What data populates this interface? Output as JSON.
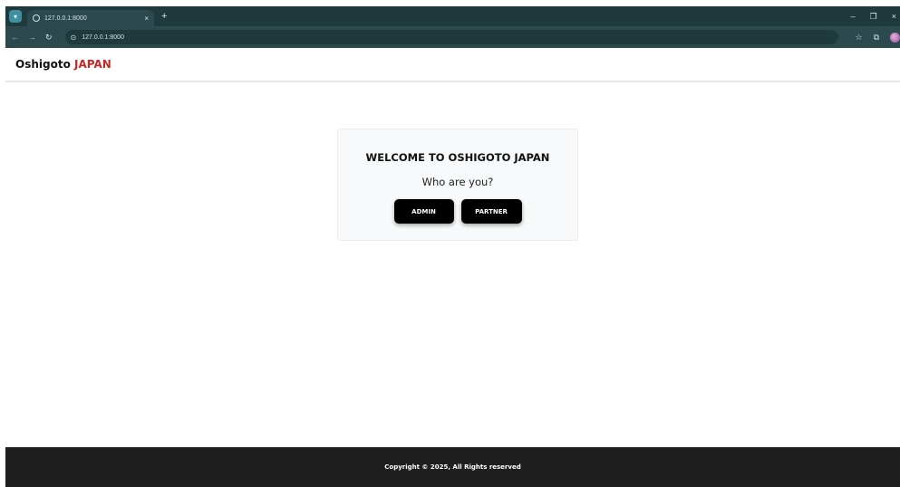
{
  "browser": {
    "tab_title": "127.0.0.1:8000",
    "tab_close": "×",
    "new_tab": "+",
    "url": "127.0.0.1:8000",
    "controls": {
      "minimize": "–",
      "restore": "❐",
      "close": "×"
    }
  },
  "navbar": {
    "brand_main": "Oshigoto",
    "brand_accent": "JAPAN"
  },
  "welcome_card": {
    "title": "WELCOME TO OSHIGOTO JAPAN",
    "subtitle": "Who are you?",
    "buttons": {
      "admin": "ADMIN",
      "partner": "PARTNER"
    }
  },
  "footer": {
    "copyright": "Copyright © 2025, All Rights reserved"
  },
  "colors": {
    "brand_accent": "#c62828",
    "button_bg": "#000000",
    "footer_bg": "#1f1f1f",
    "browser_chrome": "#1f3a3d"
  },
  "icons": {
    "globe": "globe-icon",
    "back": "arrow-left-icon",
    "forward": "arrow-right-icon",
    "reload": "reload-icon",
    "site_info": "site-info-icon",
    "bookmark": "star-icon",
    "extensions": "puzzle-icon",
    "profile": "avatar-icon"
  }
}
